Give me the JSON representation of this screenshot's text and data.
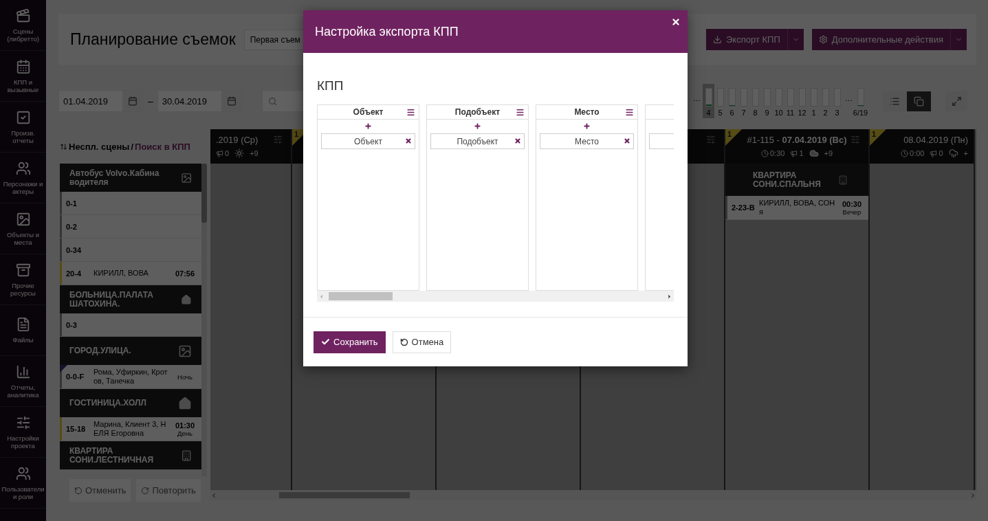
{
  "sidebar": {
    "items": [
      {
        "label": "Сцены (либретто)"
      },
      {
        "label": "КПП и вызывные"
      },
      {
        "label": "Произв. отчеты"
      },
      {
        "label": "Персонажи и актеры"
      },
      {
        "label": "Объекты и места"
      },
      {
        "label": "Прочие ресурсы"
      },
      {
        "label": "Файлы"
      },
      {
        "label": "Отчеты, аналитика"
      },
      {
        "label": "Настройки проекта"
      },
      {
        "label": "Пользователи и роли"
      }
    ]
  },
  "header": {
    "title": "Планирование съемок",
    "select": "Первая съем",
    "buttons": [
      {
        "label": "Экспорт КПП",
        "kind": "download"
      },
      {
        "label": "Дополнительные действия",
        "kind": "settings"
      }
    ]
  },
  "filters": {
    "date_from": "01.04.2019",
    "separator": "–",
    "date_to": "30.04.2019"
  },
  "days": [
    {
      "kind": "gap",
      "label": "…"
    },
    {
      "kind": "day",
      "label": "4",
      "selected": true,
      "level": 0.1
    },
    {
      "kind": "day",
      "label": "5",
      "selected": false
    },
    {
      "kind": "day",
      "label": "6",
      "selected": false,
      "level": 0.04
    },
    {
      "kind": "day",
      "label": "7",
      "selected": false
    },
    {
      "kind": "day",
      "label": "8",
      "selected": false
    },
    {
      "kind": "day",
      "label": "9",
      "selected": false
    },
    {
      "kind": "day",
      "label": "10",
      "selected": false
    },
    {
      "kind": "day",
      "label": "11",
      "selected": false
    },
    {
      "kind": "day",
      "label": "12",
      "selected": false
    },
    {
      "kind": "day",
      "label": "1",
      "selected": false
    },
    {
      "kind": "day",
      "label": "2",
      "selected": false
    },
    {
      "kind": "day",
      "label": "3",
      "selected": false
    },
    {
      "kind": "gap",
      "label": "…"
    },
    {
      "kind": "day",
      "label": "6/19",
      "selected": false,
      "level": 0.04
    }
  ],
  "view_buttons": [
    {
      "kind": "list",
      "selected": false
    },
    {
      "kind": "cascade",
      "selected": true
    }
  ],
  "unplanned": {
    "title": "Неспл. сцены",
    "separator": "/",
    "link": "Поиск в КПП",
    "groups": [
      {
        "name": "Автобус Volvo.Кабина водителя",
        "kind": "image",
        "scenes": [
          {
            "number": "0-1",
            "highlighted": false,
            "marked": false
          },
          {
            "number": "0-2",
            "highlighted": false,
            "marked": false
          },
          {
            "number": "0-34",
            "highlighted": false,
            "marked": false
          },
          {
            "number": "20-4",
            "cast": "КИРИЛЛ, ВОВА",
            "time": "07:56",
            "highlighted": true,
            "marked": false
          }
        ]
      },
      {
        "name": "БОЛЬНИЦА.ПАЛАТА ШАТОХИНА.",
        "kind": "home",
        "scenes": [
          {
            "number": "0-3",
            "highlighted": false,
            "marked": false
          }
        ]
      },
      {
        "name": "ГОРОД.УЛИЦА.",
        "kind": "image",
        "scenes": [
          {
            "number": "0-0-F",
            "cast": "Рома, Уфиркин, Кротов, Танечка",
            "period": "Ночь",
            "highlighted": false,
            "marked": true
          }
        ]
      },
      {
        "name": "ГОСТИНИЦА.ХОЛЛ",
        "kind": "home",
        "scenes": [
          {
            "number": "15-18",
            "cast": "Марина, Клиент 3, НЕЛЯ Егоровна",
            "time": "01:30",
            "period": "День",
            "highlighted": true,
            "marked": false
          }
        ]
      },
      {
        "name": "КВАРТИРА СОНИ.ЛЕСТНИЧНАЯ",
        "kind": "building"
      }
    ]
  },
  "history": [
    {
      "label": "Отменить",
      "kind": "undo",
      "disabled": true
    },
    {
      "label": "Повторить",
      "kind": "redo",
      "disabled": true
    }
  ],
  "board": {
    "columns": [
      {
        "kind": "cut-left",
        "title": ".2019 (Ср)",
        "calls": "0",
        "temperature": "+9"
      },
      {
        "kind": "hidden",
        "badge": "1"
      },
      {
        "kind": "hidden"
      },
      {
        "kind": "hidden"
      },
      {
        "kind": "full",
        "badge": "1",
        "title": "#1-115 - **07.04.2019 (Вс)**",
        "duration": "0:30",
        "calls": "1",
        "temperature": "+9",
        "groups": [
          {
            "name": "КВАРТИРА СОНИ.СПАЛЬНЯ",
            "kind": "building",
            "scenes": [
              {
                "number": "2-23-В",
                "cast": "КИРИЛЛ, ВОВА, СОНя",
                "time": "00:30",
                "period": "Вечер",
                "highlighted": false,
                "marked": false
              }
            ]
          }
        ]
      },
      {
        "kind": "cut-right",
        "badge": "1",
        "title": "08.04.2019 (Пн)",
        "duration": "0:00",
        "calls": "0",
        "temperature": "+"
      }
    ]
  },
  "modal": {
    "title": "Настройка экспорта КПП",
    "section": "КПП",
    "columns": [
      {
        "kind": "full",
        "title": "Объект",
        "items": [
          "Объект"
        ]
      },
      {
        "kind": "full",
        "title": "Подобъект",
        "items": [
          "Подобъект"
        ]
      },
      {
        "kind": "full",
        "title": "Место",
        "items": [
          "Место"
        ]
      },
      {
        "kind": "cut"
      }
    ],
    "buttons": [
      {
        "label": "Сохранить",
        "kind": "primary"
      },
      {
        "label": "Отмена",
        "kind": "default"
      }
    ]
  }
}
